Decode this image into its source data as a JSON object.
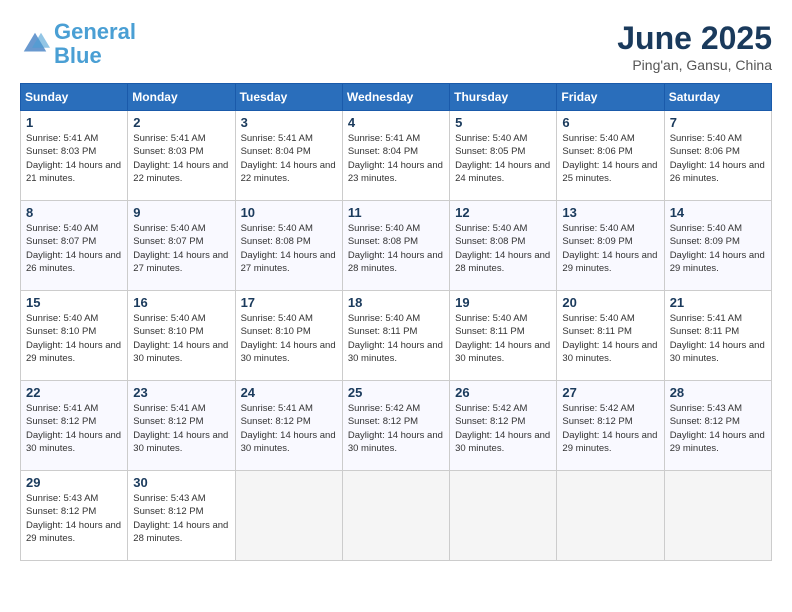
{
  "header": {
    "logo_line1": "General",
    "logo_line2": "Blue",
    "month": "June 2025",
    "location": "Ping'an, Gansu, China"
  },
  "weekdays": [
    "Sunday",
    "Monday",
    "Tuesday",
    "Wednesday",
    "Thursday",
    "Friday",
    "Saturday"
  ],
  "weeks": [
    [
      {
        "day": "1",
        "sunrise": "5:41 AM",
        "sunset": "8:03 PM",
        "daylight": "14 hours and 21 minutes."
      },
      {
        "day": "2",
        "sunrise": "5:41 AM",
        "sunset": "8:03 PM",
        "daylight": "14 hours and 22 minutes."
      },
      {
        "day": "3",
        "sunrise": "5:41 AM",
        "sunset": "8:04 PM",
        "daylight": "14 hours and 22 minutes."
      },
      {
        "day": "4",
        "sunrise": "5:41 AM",
        "sunset": "8:04 PM",
        "daylight": "14 hours and 23 minutes."
      },
      {
        "day": "5",
        "sunrise": "5:40 AM",
        "sunset": "8:05 PM",
        "daylight": "14 hours and 24 minutes."
      },
      {
        "day": "6",
        "sunrise": "5:40 AM",
        "sunset": "8:06 PM",
        "daylight": "14 hours and 25 minutes."
      },
      {
        "day": "7",
        "sunrise": "5:40 AM",
        "sunset": "8:06 PM",
        "daylight": "14 hours and 26 minutes."
      }
    ],
    [
      {
        "day": "8",
        "sunrise": "5:40 AM",
        "sunset": "8:07 PM",
        "daylight": "14 hours and 26 minutes."
      },
      {
        "day": "9",
        "sunrise": "5:40 AM",
        "sunset": "8:07 PM",
        "daylight": "14 hours and 27 minutes."
      },
      {
        "day": "10",
        "sunrise": "5:40 AM",
        "sunset": "8:08 PM",
        "daylight": "14 hours and 27 minutes."
      },
      {
        "day": "11",
        "sunrise": "5:40 AM",
        "sunset": "8:08 PM",
        "daylight": "14 hours and 28 minutes."
      },
      {
        "day": "12",
        "sunrise": "5:40 AM",
        "sunset": "8:08 PM",
        "daylight": "14 hours and 28 minutes."
      },
      {
        "day": "13",
        "sunrise": "5:40 AM",
        "sunset": "8:09 PM",
        "daylight": "14 hours and 29 minutes."
      },
      {
        "day": "14",
        "sunrise": "5:40 AM",
        "sunset": "8:09 PM",
        "daylight": "14 hours and 29 minutes."
      }
    ],
    [
      {
        "day": "15",
        "sunrise": "5:40 AM",
        "sunset": "8:10 PM",
        "daylight": "14 hours and 29 minutes."
      },
      {
        "day": "16",
        "sunrise": "5:40 AM",
        "sunset": "8:10 PM",
        "daylight": "14 hours and 30 minutes."
      },
      {
        "day": "17",
        "sunrise": "5:40 AM",
        "sunset": "8:10 PM",
        "daylight": "14 hours and 30 minutes."
      },
      {
        "day": "18",
        "sunrise": "5:40 AM",
        "sunset": "8:11 PM",
        "daylight": "14 hours and 30 minutes."
      },
      {
        "day": "19",
        "sunrise": "5:40 AM",
        "sunset": "8:11 PM",
        "daylight": "14 hours and 30 minutes."
      },
      {
        "day": "20",
        "sunrise": "5:40 AM",
        "sunset": "8:11 PM",
        "daylight": "14 hours and 30 minutes."
      },
      {
        "day": "21",
        "sunrise": "5:41 AM",
        "sunset": "8:11 PM",
        "daylight": "14 hours and 30 minutes."
      }
    ],
    [
      {
        "day": "22",
        "sunrise": "5:41 AM",
        "sunset": "8:12 PM",
        "daylight": "14 hours and 30 minutes."
      },
      {
        "day": "23",
        "sunrise": "5:41 AM",
        "sunset": "8:12 PM",
        "daylight": "14 hours and 30 minutes."
      },
      {
        "day": "24",
        "sunrise": "5:41 AM",
        "sunset": "8:12 PM",
        "daylight": "14 hours and 30 minutes."
      },
      {
        "day": "25",
        "sunrise": "5:42 AM",
        "sunset": "8:12 PM",
        "daylight": "14 hours and 30 minutes."
      },
      {
        "day": "26",
        "sunrise": "5:42 AM",
        "sunset": "8:12 PM",
        "daylight": "14 hours and 30 minutes."
      },
      {
        "day": "27",
        "sunrise": "5:42 AM",
        "sunset": "8:12 PM",
        "daylight": "14 hours and 29 minutes."
      },
      {
        "day": "28",
        "sunrise": "5:43 AM",
        "sunset": "8:12 PM",
        "daylight": "14 hours and 29 minutes."
      }
    ],
    [
      {
        "day": "29",
        "sunrise": "5:43 AM",
        "sunset": "8:12 PM",
        "daylight": "14 hours and 29 minutes."
      },
      {
        "day": "30",
        "sunrise": "5:43 AM",
        "sunset": "8:12 PM",
        "daylight": "14 hours and 28 minutes."
      },
      null,
      null,
      null,
      null,
      null
    ]
  ]
}
